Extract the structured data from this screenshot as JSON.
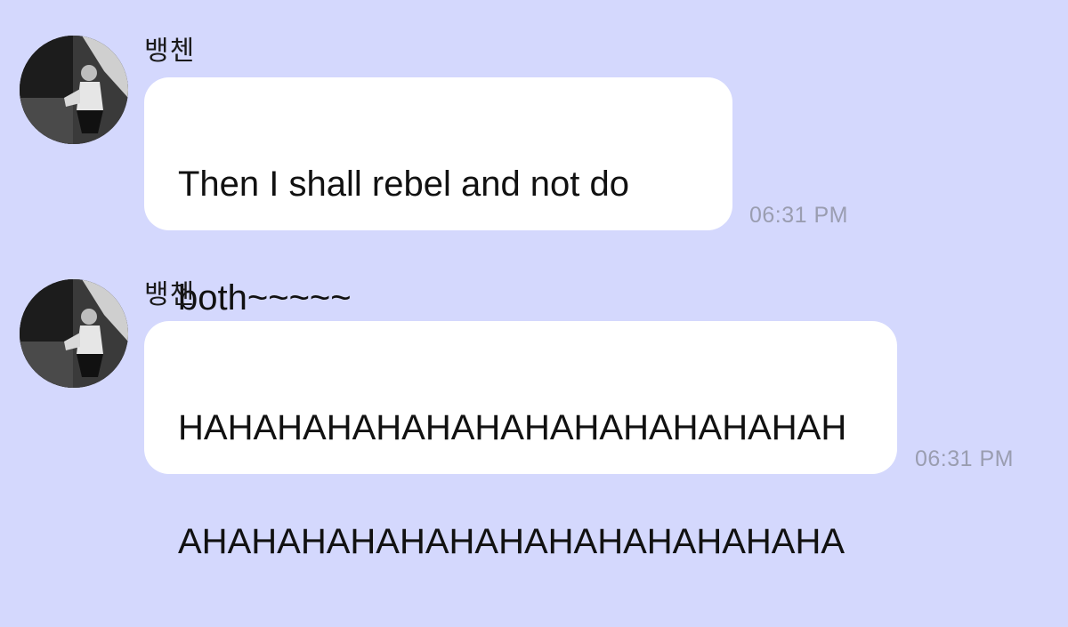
{
  "messages": [
    {
      "sender": "뱅첸",
      "avatar": "avatar-photo",
      "text_lines": [
        "Then I shall rebel and not do",
        "both~~~~~"
      ],
      "time": "06:31 PM"
    },
    {
      "sender": "뱅첸",
      "avatar": "avatar-photo",
      "text_lines": [
        "HAHAHAHAHAHAHAHAHAHAHAHAHAH",
        "AHAHAHAHAHAHAHAHAHAHAHAHAHA"
      ],
      "time": "06:31 PM"
    }
  ],
  "colors": {
    "background": "#d4d8fd",
    "bubble": "#ffffff",
    "timestamp": "#9a9db0",
    "text": "#111111"
  }
}
